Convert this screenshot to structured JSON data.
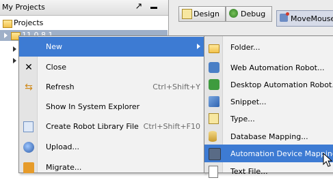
{
  "projects_panel": {
    "title": "My Projects",
    "tree": [
      {
        "label": "Projects"
      },
      {
        "label": "11.0.8.1..."
      }
    ]
  },
  "editor": {
    "tabs": [
      {
        "label": "Design"
      },
      {
        "label": "Debug"
      }
    ],
    "file_tab": "MoveMouse..."
  },
  "context_menu": {
    "items": [
      {
        "label": "New",
        "shortcut": "",
        "icon": "none",
        "highlighted": true
      },
      {
        "label": "Close",
        "shortcut": "",
        "icon": "close-icon"
      },
      {
        "label": "Refresh",
        "shortcut": "Ctrl+Shift+Y",
        "icon": "refresh-icon"
      },
      {
        "label": "Show In System Explorer",
        "shortcut": "",
        "icon": "none"
      },
      {
        "label": "Create Robot Library File",
        "shortcut": "Ctrl+Shift+F10",
        "icon": "library-icon"
      },
      {
        "label": "Upload...",
        "shortcut": "",
        "icon": "upload-icon"
      },
      {
        "label": "Migrate...",
        "shortcut": "",
        "icon": "migrate-icon"
      }
    ]
  },
  "submenu": {
    "items": [
      {
        "label": "Folder...",
        "icon": "folder-icon"
      },
      {
        "label": "Web Automation Robot...",
        "icon": "web-robot-icon"
      },
      {
        "label": "Desktop Automation Robot...",
        "icon": "desktop-robot-icon"
      },
      {
        "label": "Snippet...",
        "icon": "snippet-icon"
      },
      {
        "label": "Type...",
        "icon": "type-icon"
      },
      {
        "label": "Database Mapping...",
        "icon": "database-icon"
      },
      {
        "label": "Automation Device Mapping...",
        "icon": "device-mapping-icon",
        "highlighted": true
      },
      {
        "label": "Text File...",
        "icon": "text-file-icon"
      }
    ]
  },
  "colors": {
    "menu_highlight": "#3d7bd3",
    "tree_selection": "#9fb0c8"
  }
}
